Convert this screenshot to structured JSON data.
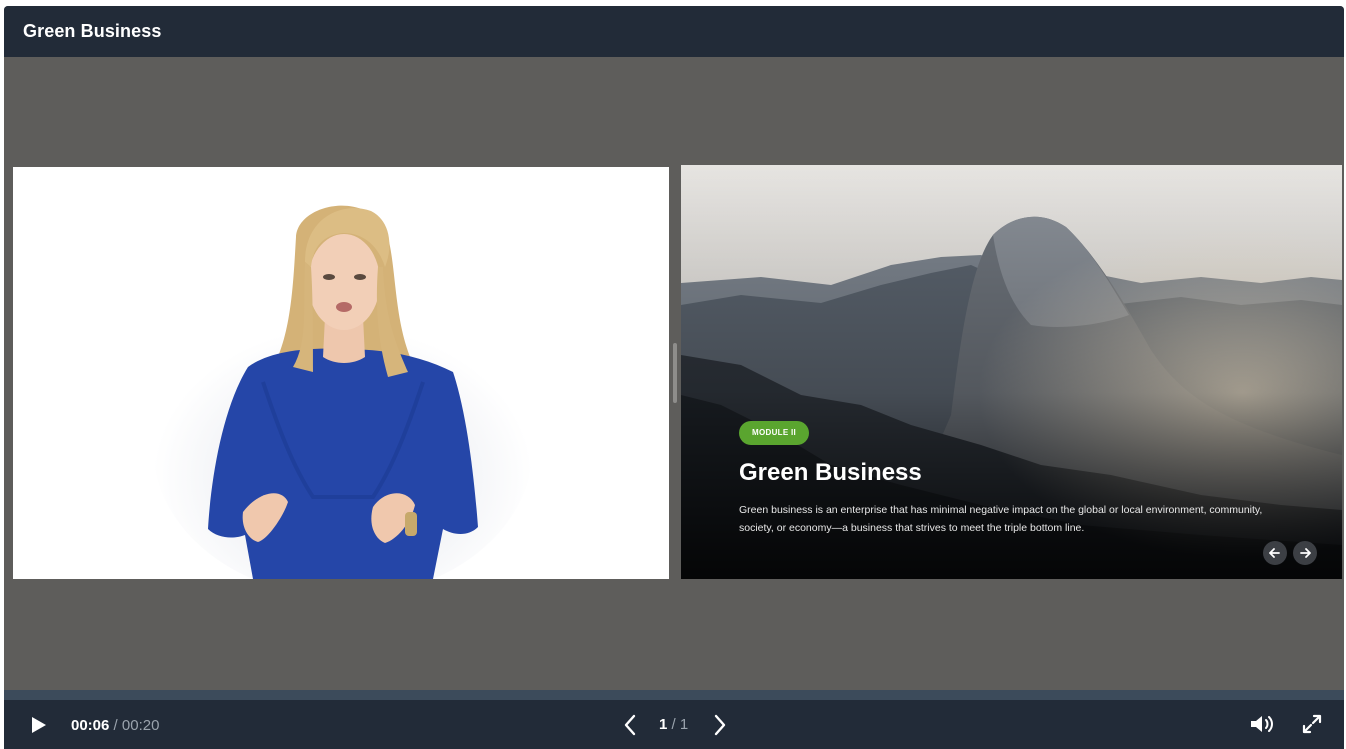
{
  "window": {
    "title": "Green Business"
  },
  "slide": {
    "badge": "MODULE II",
    "title": "Green Business",
    "description": "Green business is an enterprise that has minimal negative impact on the global or local environment, community, society, or economy—a business that strives to meet the triple bottom line."
  },
  "controls": {
    "current_time": "00:06",
    "separator": "/",
    "total_time": "00:20",
    "page_current": "1",
    "page_separator": "/",
    "page_total": "1"
  },
  "colors": {
    "titlebar": "#222b38",
    "stage": "#5e5d5b",
    "badge": "#5aa52f",
    "dress": "#2546a8"
  }
}
